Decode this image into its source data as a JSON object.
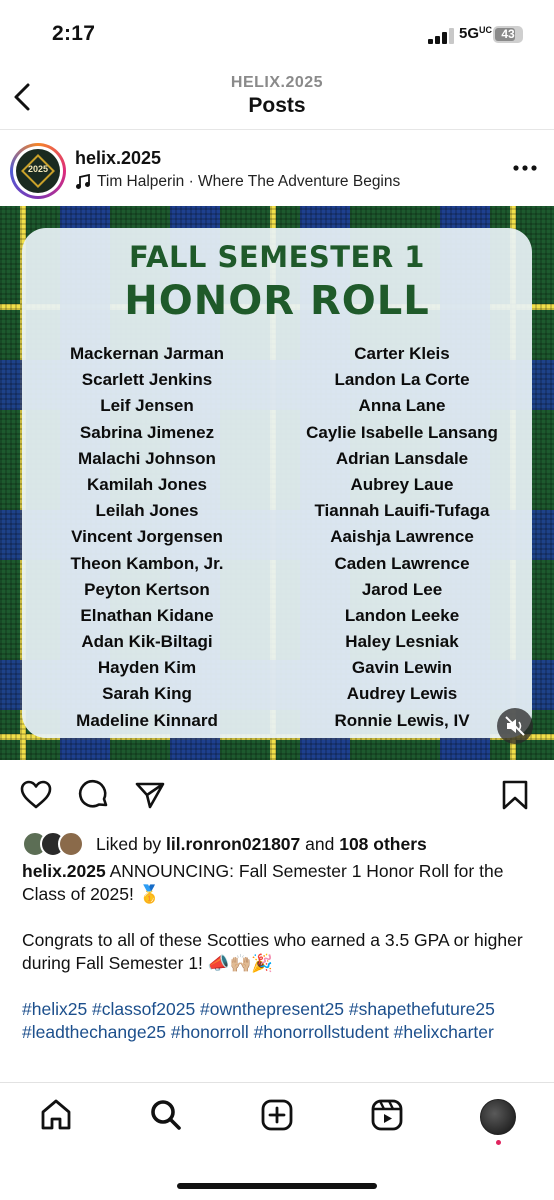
{
  "status_bar": {
    "time": "2:17",
    "network": "5G",
    "network_suffix": "UC",
    "battery": "43"
  },
  "header": {
    "subtitle": "HELIX.2025",
    "title": "Posts",
    "back_icon": "chevron-left-icon"
  },
  "post": {
    "username": "helix.2025",
    "avatar_year": "2025",
    "audio": "Tim Halperin · Where The Adventure Begins",
    "more_icon": "more-horizontal-icon"
  },
  "graphic": {
    "title_line1": "FALL SEMESTER 1",
    "title_line2": "HONOR ROLL",
    "left_names": [
      "Mackernan Jarman",
      "Scarlett Jenkins",
      "Leif Jensen",
      "Sabrina Jimenez",
      "Malachi Johnson",
      "Kamilah Jones",
      "Leilah Jones",
      "Vincent Jorgensen",
      "Theon Kambon, Jr.",
      "Peyton Kertson",
      "Elnathan Kidane",
      "Adan Kik-Biltagi",
      "Hayden Kim",
      "Sarah King",
      "Madeline Kinnard"
    ],
    "right_names": [
      "Carter Kleis",
      "Landon La Corte",
      "Anna Lane",
      "Caylie Isabelle Lansang",
      "Adrian Lansdale",
      "Aubrey Laue",
      "Tiannah Lauifi-Tufaga",
      "Aaishja Lawrence",
      "Caden Lawrence",
      "Jarod Lee",
      "Landon Leeke",
      "Haley Lesniak",
      "Gavin Lewin",
      "Audrey Lewis",
      "Ronnie Lewis, IV"
    ],
    "colors": {
      "title_green": "#1f5a2a",
      "plaid_green": "#1d5a2e",
      "plaid_blue": "#1e3ca0",
      "plaid_yellow": "#f1e04a"
    }
  },
  "actions": {
    "like_icon": "heart-icon",
    "comment_icon": "comment-icon",
    "share_icon": "send-icon",
    "save_icon": "bookmark-icon"
  },
  "likes": {
    "prefix": "Liked by ",
    "user": "lil.ronron021807",
    "middle": " and ",
    "others": "108 others"
  },
  "caption": {
    "username": "helix.2025",
    "line1": " ANNOUNCING: Fall Semester 1 Honor Roll for the Class of 2025! 🥇",
    "line2": "Congrats to all of these Scotties who earned a 3.5 GPA or higher during Fall Semester 1! 📣🙌🏼🎉",
    "hashtags": "#helix25 #classof2025 #ownthepresent25 #shapethefuture25 #leadthechange25 #honorroll #honorrollstudent #helixcharter"
  },
  "bottom_nav": {
    "items": [
      "home-icon",
      "search-icon",
      "create-icon",
      "reels-icon",
      "profile-avatar"
    ]
  }
}
